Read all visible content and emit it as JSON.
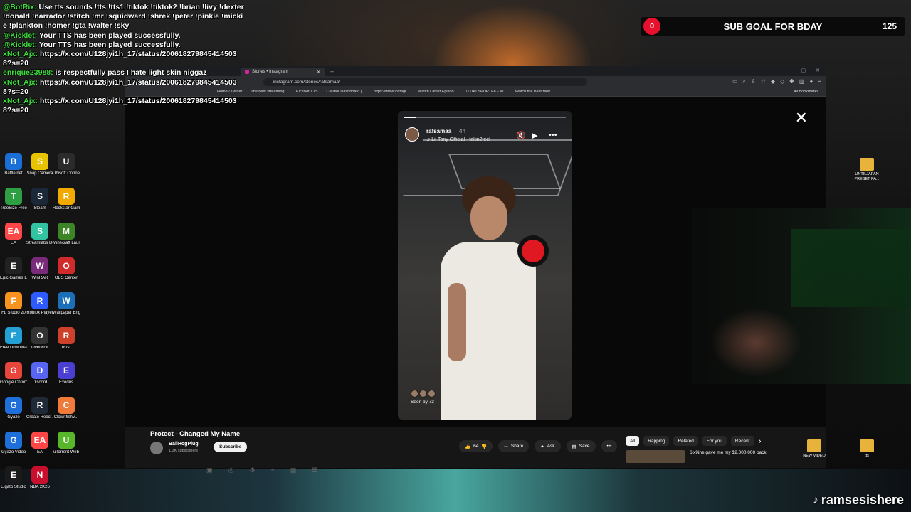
{
  "chat": [
    {
      "user": "@BotRix:",
      "text": "Use tts sounds !tts !tts1 !tiktok !tiktok2 !brian !livy !dexter !donald !narrador !stitch !mr !squidward !shrek !peter !pinkie !mickie !plankton !homer !gta !walter !sky"
    },
    {
      "user": "@Kicklet:",
      "text": "Your TTS has been played successfully."
    },
    {
      "user": "@Kicklet:",
      "text": "Your TTS has been played successfully."
    },
    {
      "user": "xNot_Ajx:",
      "text": "https://x.com/U128jyi1h_17/status/2006182798454145038?s=20"
    },
    {
      "user": "enrique23988:",
      "text": "is respectfully pass I hate light skin niggaz"
    },
    {
      "user": "xNot_Ajx:",
      "text": "https://x.com/U128jyi1h_17/status/2006182798454145038?s=20"
    },
    {
      "user": "xNot_Ajx:",
      "text": "https://x.com/U128jyi1h_17/status/2006182798454145038?s=20"
    }
  ],
  "subgoal": {
    "count": "0",
    "title": "SUB GOAL FOR BDAY",
    "target": "125"
  },
  "browser": {
    "tab_title": "Stories • Instagram",
    "url": "instagram.com/stories/rafsamaa/",
    "bookmarks": [
      "Home / Twitter",
      "The best streaming...",
      "KickBot TTS",
      "Creator Dashboard |...",
      "https://www.instagr...",
      "Watch Latest Episod...",
      "TOTALSPORTEK - W...",
      "Watch the Best Mov..."
    ],
    "all_bookmarks": "All Bookmarks"
  },
  "story": {
    "username": "rafsamaa",
    "time": "4h",
    "music": "Lil Tony Official · fallin2feel",
    "seen": "Seen by 73",
    "progress": 0.08
  },
  "video": {
    "title": "Protect - Changed My Name",
    "channel": "BallHogPlug",
    "subscribers": "1.3K subscribers",
    "subscribe": "Subscribe",
    "likes": "64",
    "share": "Share",
    "ask": "Ask",
    "save": "Save",
    "chips": [
      "All",
      "Rapping",
      "Related",
      "For you",
      "Recent"
    ],
    "rec_title": "6ix9ine gave me my $2,000,000 back!"
  },
  "desktop_icons": [
    {
      "label": "Battle.net",
      "color": "#1a6fd6",
      "glyph": "B"
    },
    {
      "label": "Snap Camera",
      "color": "#e8c400",
      "glyph": "S"
    },
    {
      "label": "Ubisoft Connect",
      "color": "#2b2b2b",
      "glyph": "U"
    },
    {
      "label": "TreeSize Free",
      "color": "#2ea043",
      "glyph": "T"
    },
    {
      "label": "Steam",
      "color": "#1b2838",
      "glyph": "S"
    },
    {
      "label": "Rockstar Games",
      "color": "#f2a900",
      "glyph": "R"
    },
    {
      "label": "EA",
      "color": "#ff4747",
      "glyph": "EA"
    },
    {
      "label": "Streamlabs Desktop",
      "color": "#31c3a2",
      "glyph": "S"
    },
    {
      "label": "Minecraft Launcher",
      "color": "#3c8527",
      "glyph": "M"
    },
    {
      "label": "Epic Games Launcher",
      "color": "#222",
      "glyph": "E"
    },
    {
      "label": "WinRAR",
      "color": "#7a2a7a",
      "glyph": "W"
    },
    {
      "label": "OBS Center",
      "color": "#d12a2a",
      "glyph": "O"
    },
    {
      "label": "FL Studio 20",
      "color": "#f7931e",
      "glyph": "F"
    },
    {
      "label": "Roblox Player",
      "color": "#2d5bff",
      "glyph": "R"
    },
    {
      "label": "Wallpaper Engine",
      "color": "#1b6fb8",
      "glyph": "W"
    },
    {
      "label": "Free Download",
      "color": "#22a0d6",
      "glyph": "F"
    },
    {
      "label": "Overwolf",
      "color": "#333",
      "glyph": "O"
    },
    {
      "label": "Rust",
      "color": "#cd412b",
      "glyph": "R"
    },
    {
      "label": "Google Chrome",
      "color": "#e8453c",
      "glyph": "G"
    },
    {
      "label": "Discord",
      "color": "#5865f2",
      "glyph": "D"
    },
    {
      "label": "Exodus",
      "color": "#4b3fd1",
      "glyph": "E"
    },
    {
      "label": "Gyazo",
      "color": "#1e6fd9",
      "glyph": "G"
    },
    {
      "label": "Create React App Sample",
      "color": "#1f2a36",
      "glyph": "R"
    },
    {
      "label": "ClownfishV...",
      "color": "#f07a3a",
      "glyph": "C"
    },
    {
      "label": "Gyazo Video",
      "color": "#1e6fd9",
      "glyph": "G"
    },
    {
      "label": "EA",
      "color": "#ff4747",
      "glyph": "EA"
    },
    {
      "label": "uTorrent Web",
      "color": "#58b62a",
      "glyph": "U"
    },
    {
      "label": "Elgato Studio",
      "color": "#1a1a1a",
      "glyph": "E"
    },
    {
      "label": "NBA 2K26",
      "color": "#c8102e",
      "glyph": "N"
    }
  ],
  "right_icons": [
    {
      "label": "UNTILJAPAN PRESET PA..."
    },
    {
      "label": "NEW VIDEO"
    },
    {
      "label": "tts"
    }
  ],
  "watermark": "ramsesishere"
}
